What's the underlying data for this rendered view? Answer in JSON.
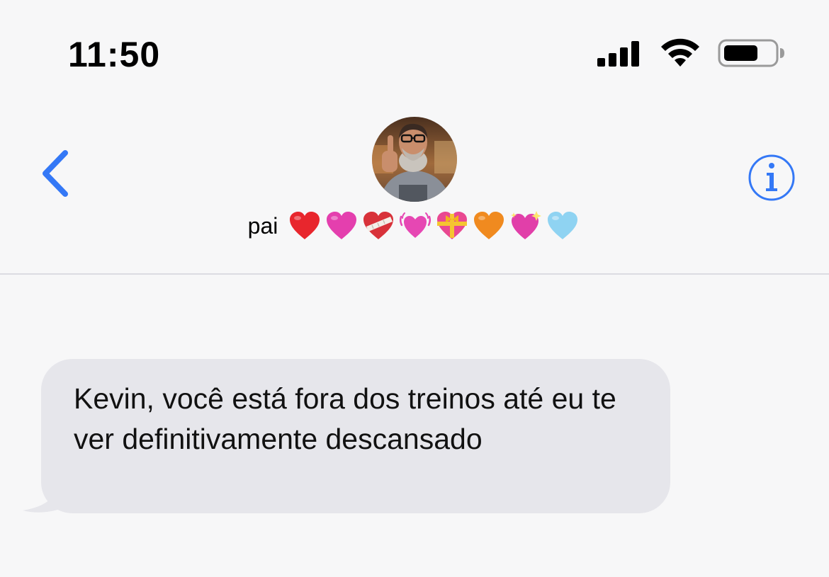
{
  "status_bar": {
    "time": "11:50"
  },
  "header": {
    "contact_name": "pai",
    "hearts": [
      {
        "icon": "red-heart-icon",
        "color": "#e8262d"
      },
      {
        "icon": "pink-heart-icon",
        "color": "#e43fae"
      },
      {
        "icon": "mending-heart-icon",
        "color": "#d8323a"
      },
      {
        "icon": "beating-heart-icon",
        "color": "#e647b3"
      },
      {
        "icon": "heart-with-ribbon-icon",
        "color": "#e94891"
      },
      {
        "icon": "orange-heart-icon",
        "color": "#f08a1f"
      },
      {
        "icon": "sparkling-heart-icon",
        "color": "#e13fa9"
      },
      {
        "icon": "light-blue-heart-icon",
        "color": "#8fd3f2"
      }
    ],
    "back_icon": "chevron-left-icon",
    "info_icon": "info-icon",
    "accent_color": "#3478f6"
  },
  "messages": [
    {
      "direction": "incoming",
      "text": "Kevin, você está fora dos treinos até eu te ver definitivamente descansado"
    }
  ]
}
